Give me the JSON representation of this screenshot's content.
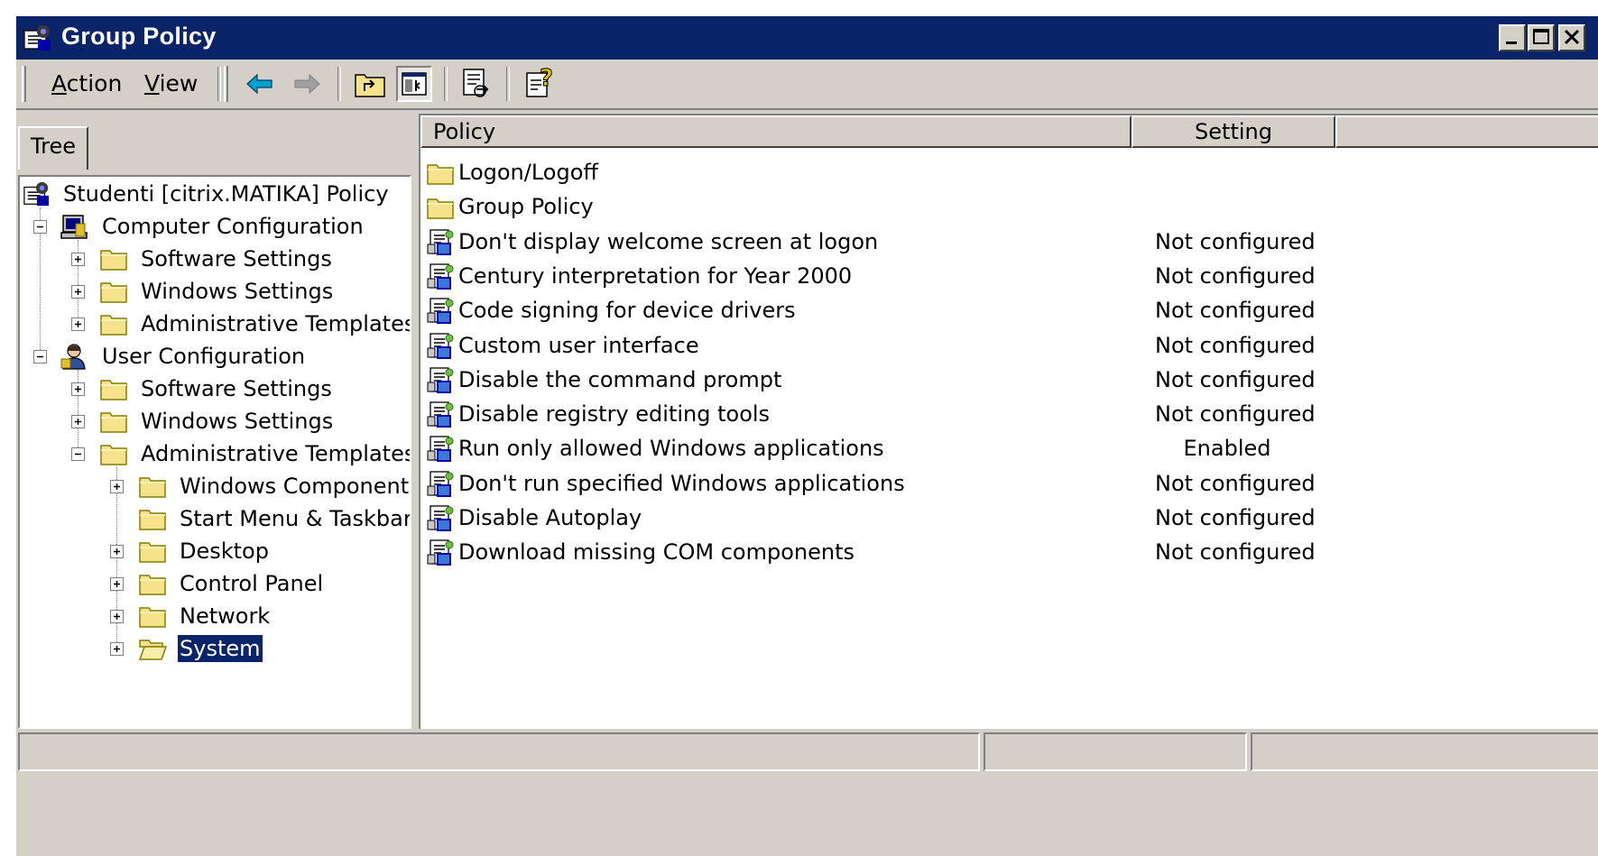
{
  "window": {
    "title": "Group Policy"
  },
  "menu": {
    "action": "Action",
    "view": "View"
  },
  "tabs": {
    "tree": "Tree"
  },
  "tree": {
    "root": "Studenti [citrix.MATIKA] Policy",
    "computer_configuration": "Computer Configuration",
    "cc_software_settings": "Software Settings",
    "cc_windows_settings": "Windows Settings",
    "cc_admin_templates": "Administrative Templates",
    "user_configuration": "User Configuration",
    "uc_software_settings": "Software Settings",
    "uc_windows_settings": "Windows Settings",
    "uc_admin_templates": "Administrative Templates",
    "windows_components": "Windows Components",
    "start_menu_taskbar": "Start Menu & Taskbar",
    "desktop": "Desktop",
    "control_panel": "Control Panel",
    "network": "Network",
    "system": "System"
  },
  "list": {
    "columns": {
      "policy": "Policy",
      "setting": "Setting"
    },
    "rows": [
      {
        "name": "Logon/Logoff",
        "setting": "",
        "type": "folder"
      },
      {
        "name": "Group Policy",
        "setting": "",
        "type": "folder"
      },
      {
        "name": "Don't display welcome screen at logon",
        "setting": "Not configured",
        "type": "policy"
      },
      {
        "name": "Century interpretation for Year 2000",
        "setting": "Not configured",
        "type": "policy"
      },
      {
        "name": "Code signing for device drivers",
        "setting": "Not configured",
        "type": "policy"
      },
      {
        "name": "Custom user interface",
        "setting": "Not configured",
        "type": "policy"
      },
      {
        "name": "Disable the command prompt",
        "setting": "Not configured",
        "type": "policy"
      },
      {
        "name": "Disable registry editing tools",
        "setting": "Not configured",
        "type": "policy"
      },
      {
        "name": "Run only allowed Windows applications",
        "setting": "Enabled",
        "type": "policy"
      },
      {
        "name": "Don't run specified Windows applications",
        "setting": "Not configured",
        "type": "policy"
      },
      {
        "name": "Disable Autoplay",
        "setting": "Not configured",
        "type": "policy"
      },
      {
        "name": "Download missing COM components",
        "setting": "Not configured",
        "type": "policy"
      }
    ]
  },
  "colors": {
    "titlebar": "#0a246a",
    "face": "#d4d0c8",
    "selection": "#0a246a",
    "folder": "#f5e28a"
  }
}
